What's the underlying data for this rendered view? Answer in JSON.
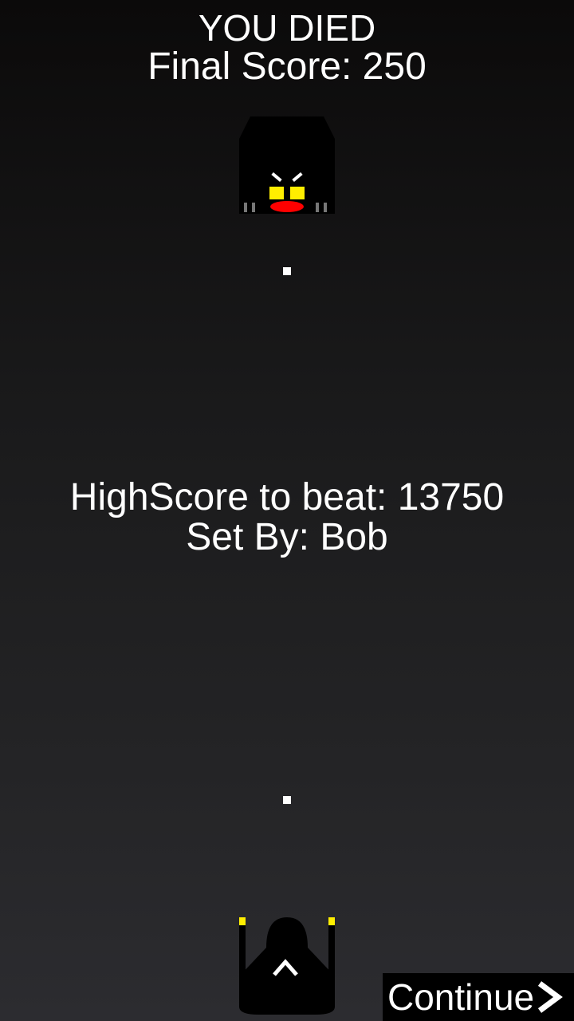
{
  "game_over": {
    "title": "YOU DIED",
    "final_score_text": "Final Score: 250"
  },
  "highscore": {
    "beat_text": "HighScore to beat: 13750",
    "set_by_text": "Set By: Bob"
  },
  "continue_button": {
    "label": "Continue",
    "icon": "chevron-right-icon"
  },
  "sprites": {
    "enemy": "enemy-ship-icon",
    "player": "player-ship-icon",
    "projectile": "bullet-icon"
  },
  "colors": {
    "text": "#ffffff",
    "enemy_eyes": "#ffee00",
    "enemy_mouth": "#ff0000",
    "player_tips": "#ffee00"
  }
}
